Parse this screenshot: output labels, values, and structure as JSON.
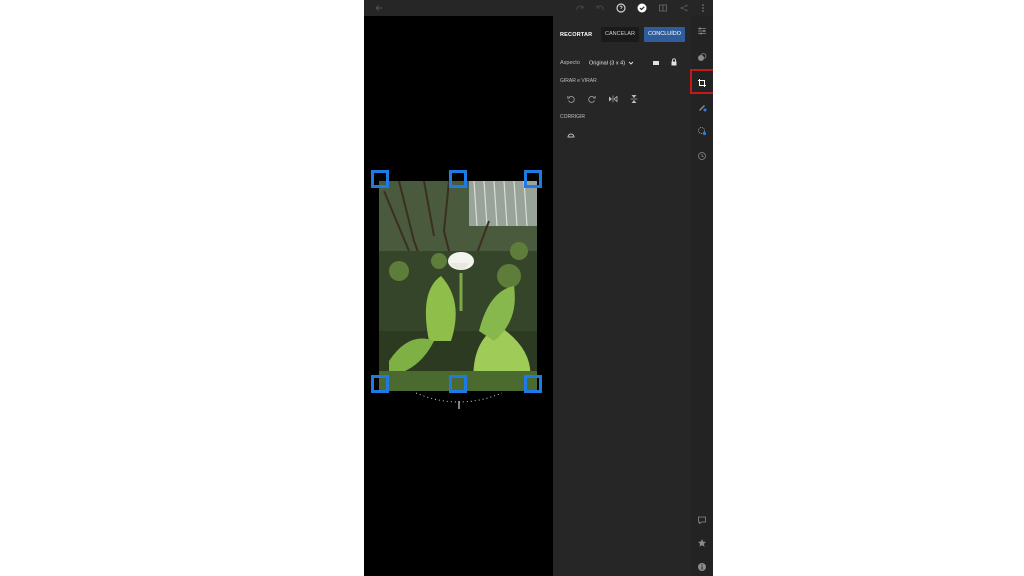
{
  "panel": {
    "title": "RECORTAR",
    "cancel_label": "CANCELAR",
    "done_label": "CONCLUÍDO",
    "aspect_label": "Aspecto",
    "aspect_value": "Original (3 x 4)",
    "rotate_section_label": "GIRAR e VIRAR",
    "straighten_section_label": "CORRIGIR"
  },
  "topbar": {
    "icons": [
      "back-arrow-icon",
      "redo-icon",
      "undo-icon",
      "help-icon",
      "check-circle-icon",
      "compare-icon",
      "share-icon",
      "more-icon"
    ]
  },
  "rail": {
    "icons": [
      "adjust-sliders-icon",
      "presets-icon",
      "crop-rotate-icon",
      "healing-brush-icon",
      "selective-adjust-icon",
      "history-icon",
      "comment-icon",
      "star-icon",
      "info-icon"
    ],
    "active": "crop-rotate-icon"
  },
  "colors": {
    "accent": "#2f5d9c",
    "handle": "#1e7be6",
    "highlight": "#c11a1a"
  }
}
